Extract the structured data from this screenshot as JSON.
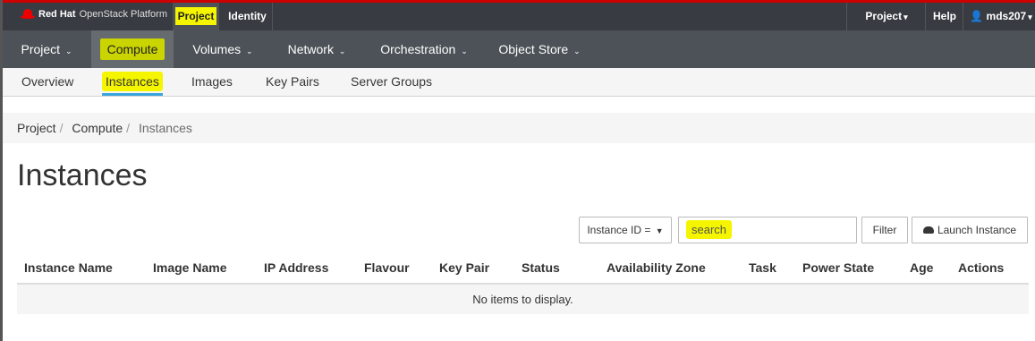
{
  "brand": {
    "name_bold": "Red Hat",
    "name_rest": "OpenStack Platform"
  },
  "top_tabs": {
    "project": "Project",
    "identity": "Identity"
  },
  "top_right": {
    "project": "Project",
    "help": "Help",
    "user": "mds207"
  },
  "main_nav": [
    "Project",
    "Compute",
    "Volumes",
    "Network",
    "Orchestration",
    "Object Store"
  ],
  "sub_nav": [
    "Overview",
    "Instances",
    "Images",
    "Key Pairs",
    "Server Groups"
  ],
  "breadcrumb": [
    "Project",
    "Compute",
    "Instances"
  ],
  "page_title": "Instances",
  "toolbar": {
    "filter_field": "Instance ID =",
    "search_placeholder": "search",
    "filter_label": "Filter",
    "launch_label": "Launch Instance"
  },
  "table": {
    "columns": [
      "Instance Name",
      "Image Name",
      "IP Address",
      "Flavour",
      "Key Pair",
      "Status",
      "Availability Zone",
      "Task",
      "Power State",
      "Age",
      "Actions"
    ],
    "empty_message": "No items to display."
  },
  "colors": {
    "accent_red": "#cc0000",
    "highlight": "#f5f500",
    "active_tab_underline": "#39a5dc"
  }
}
